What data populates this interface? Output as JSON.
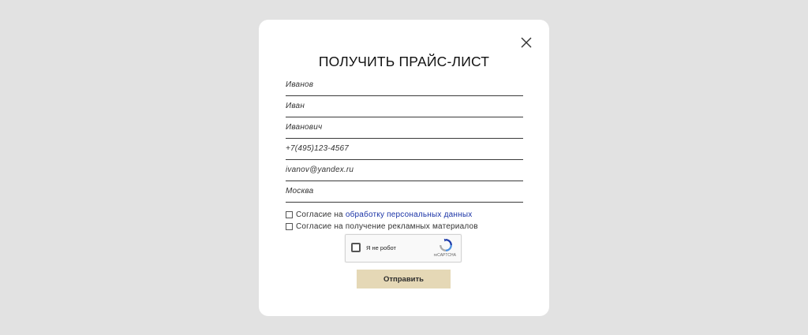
{
  "modal": {
    "title": "ПОЛУЧИТЬ ПРАЙС-ЛИСТ",
    "close_icon": "close-icon"
  },
  "form": {
    "fields": [
      {
        "name": "last-name",
        "value": "Иванов"
      },
      {
        "name": "first-name",
        "value": "Иван"
      },
      {
        "name": "middle-name",
        "value": "Иванович"
      },
      {
        "name": "phone",
        "value": "+7(495)123-4567"
      },
      {
        "name": "email",
        "value": "ivanov@yandex.ru"
      },
      {
        "name": "city",
        "value": "Москва"
      }
    ],
    "consent_personal": {
      "prefix": "Согласие на",
      "link": "обработку персональных данных",
      "checked": false
    },
    "consent_ads": {
      "label": "Согласие на получение рекламных материалов",
      "checked": false
    },
    "recaptcha": {
      "label": "Я не робот",
      "brand": "reCAPTCHA"
    },
    "submit_label": "Отправить"
  },
  "colors": {
    "overlay": "#e2e2e2",
    "modal": "#ffffff",
    "submit": "#e5d8b6",
    "link": "#1a33a6"
  }
}
